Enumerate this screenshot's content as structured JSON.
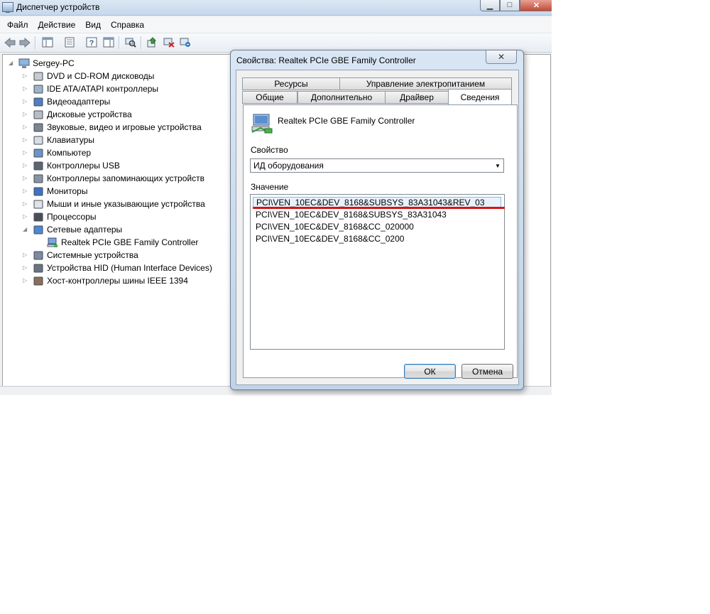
{
  "window": {
    "title": "Диспетчер устройств"
  },
  "menu": [
    "Файл",
    "Действие",
    "Вид",
    "Справка"
  ],
  "toolbar": {
    "icons": [
      "back-icon",
      "forward-icon",
      "show-hide-tree-icon",
      "properties-icon",
      "help-icon",
      "action-pane-icon",
      "scan-hardware-icon",
      "update-driver-icon",
      "disable-device-icon",
      "uninstall-device-icon"
    ]
  },
  "tree": {
    "root": "Sergey-PC",
    "categories": [
      "DVD и CD-ROM дисководы",
      "IDE ATA/ATAPI контроллеры",
      "Видеоадаптеры",
      "Дисковые устройства",
      "Звуковые, видео и игровые устройства",
      "Клавиатуры",
      "Компьютер",
      "Контроллеры USB",
      "Контроллеры запоминающих устройств",
      "Мониторы",
      "Мыши и иные указывающие устройства",
      "Процессоры",
      "Сетевые адаптеры",
      "Системные устройства",
      "Устройства HID (Human Interface Devices)",
      "Хост-контроллеры шины IEEE 1394"
    ],
    "expanded_child": "Realtek PCIe GBE Family Controller"
  },
  "dialog": {
    "title": "Свойства: Realtek PCIe GBE Family Controller",
    "close_glyph": "✕",
    "tabs_back": [
      "Ресурсы",
      "Управление электропитанием"
    ],
    "tabs_front": [
      "Общие",
      "Дополнительно",
      "Драйвер",
      "Сведения"
    ],
    "active_tab": "Сведения",
    "device_name": "Realtek PCIe GBE Family Controller",
    "property_label": "Свойство",
    "property_value": "ИД оборудования",
    "value_label": "Значение",
    "values": [
      "PCI\\VEN_10EC&DEV_8168&SUBSYS_83A31043&REV_03",
      "PCI\\VEN_10EC&DEV_8168&SUBSYS_83A31043",
      "PCI\\VEN_10EC&DEV_8168&CC_020000",
      "PCI\\VEN_10EC&DEV_8168&CC_0200"
    ],
    "ok_label": "ОК",
    "cancel_label": "Отмена"
  },
  "colors": {
    "highlight_underline": "#d41414",
    "selection_bg": "#e8f2fc"
  }
}
